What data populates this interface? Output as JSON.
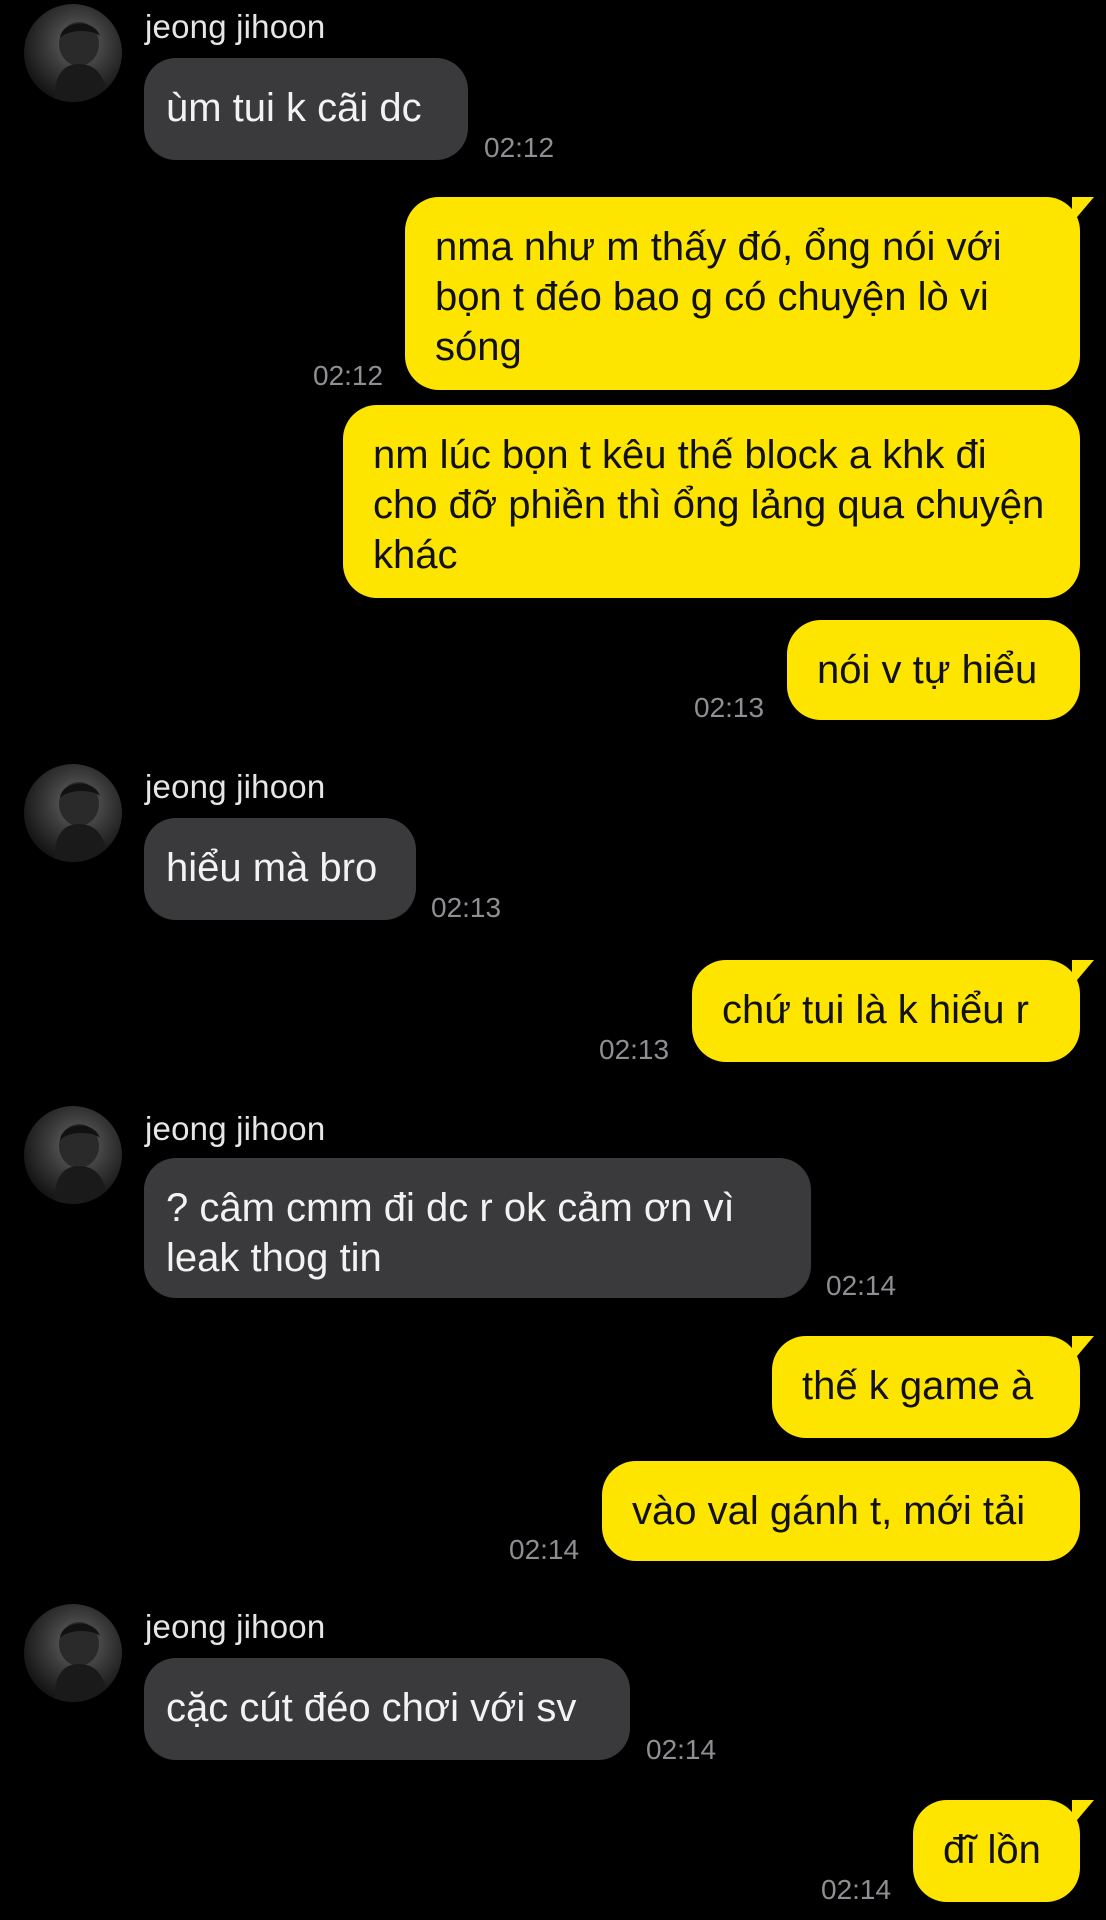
{
  "contact": {
    "name": "jeong jihoon"
  },
  "colors": {
    "background": "#000000",
    "incoming_bubble": "#3a3a3c",
    "outgoing_bubble": "#fee500",
    "timestamp": "#8e8e93"
  },
  "messages": [
    {
      "sender": "jeong jihoon",
      "direction": "incoming",
      "text": "ùm tui k cãi dc",
      "time": "02:12"
    },
    {
      "direction": "outgoing",
      "text": "nma như m thấy đó, ổng nói với bọn t đéo bao g có chuyện lò vi sóng",
      "time": "02:12"
    },
    {
      "direction": "outgoing",
      "text": "nm lúc bọn t kêu thế block a khk đi cho đỡ phiền thì ổng lảng qua chuyện khác"
    },
    {
      "direction": "outgoing",
      "text": "nói v tự hiểu",
      "time": "02:13"
    },
    {
      "sender": "jeong jihoon",
      "direction": "incoming",
      "text": "hiểu mà bro",
      "time": "02:13"
    },
    {
      "direction": "outgoing",
      "text": "chứ tui là k hiểu r",
      "time": "02:13"
    },
    {
      "sender": "jeong jihoon",
      "direction": "incoming",
      "text": "? câm cmm đi dc r ok cảm ơn vì leak thog tin",
      "time": "02:14"
    },
    {
      "direction": "outgoing",
      "text": "thế k game à"
    },
    {
      "direction": "outgoing",
      "text": "vào val gánh t, mới tải",
      "time": "02:14"
    },
    {
      "sender": "jeong jihoon",
      "direction": "incoming",
      "text": "cặc cút đéo chơi với sv",
      "time": "02:14"
    },
    {
      "direction": "outgoing",
      "text": "đĩ lồn",
      "time": "02:14"
    }
  ]
}
